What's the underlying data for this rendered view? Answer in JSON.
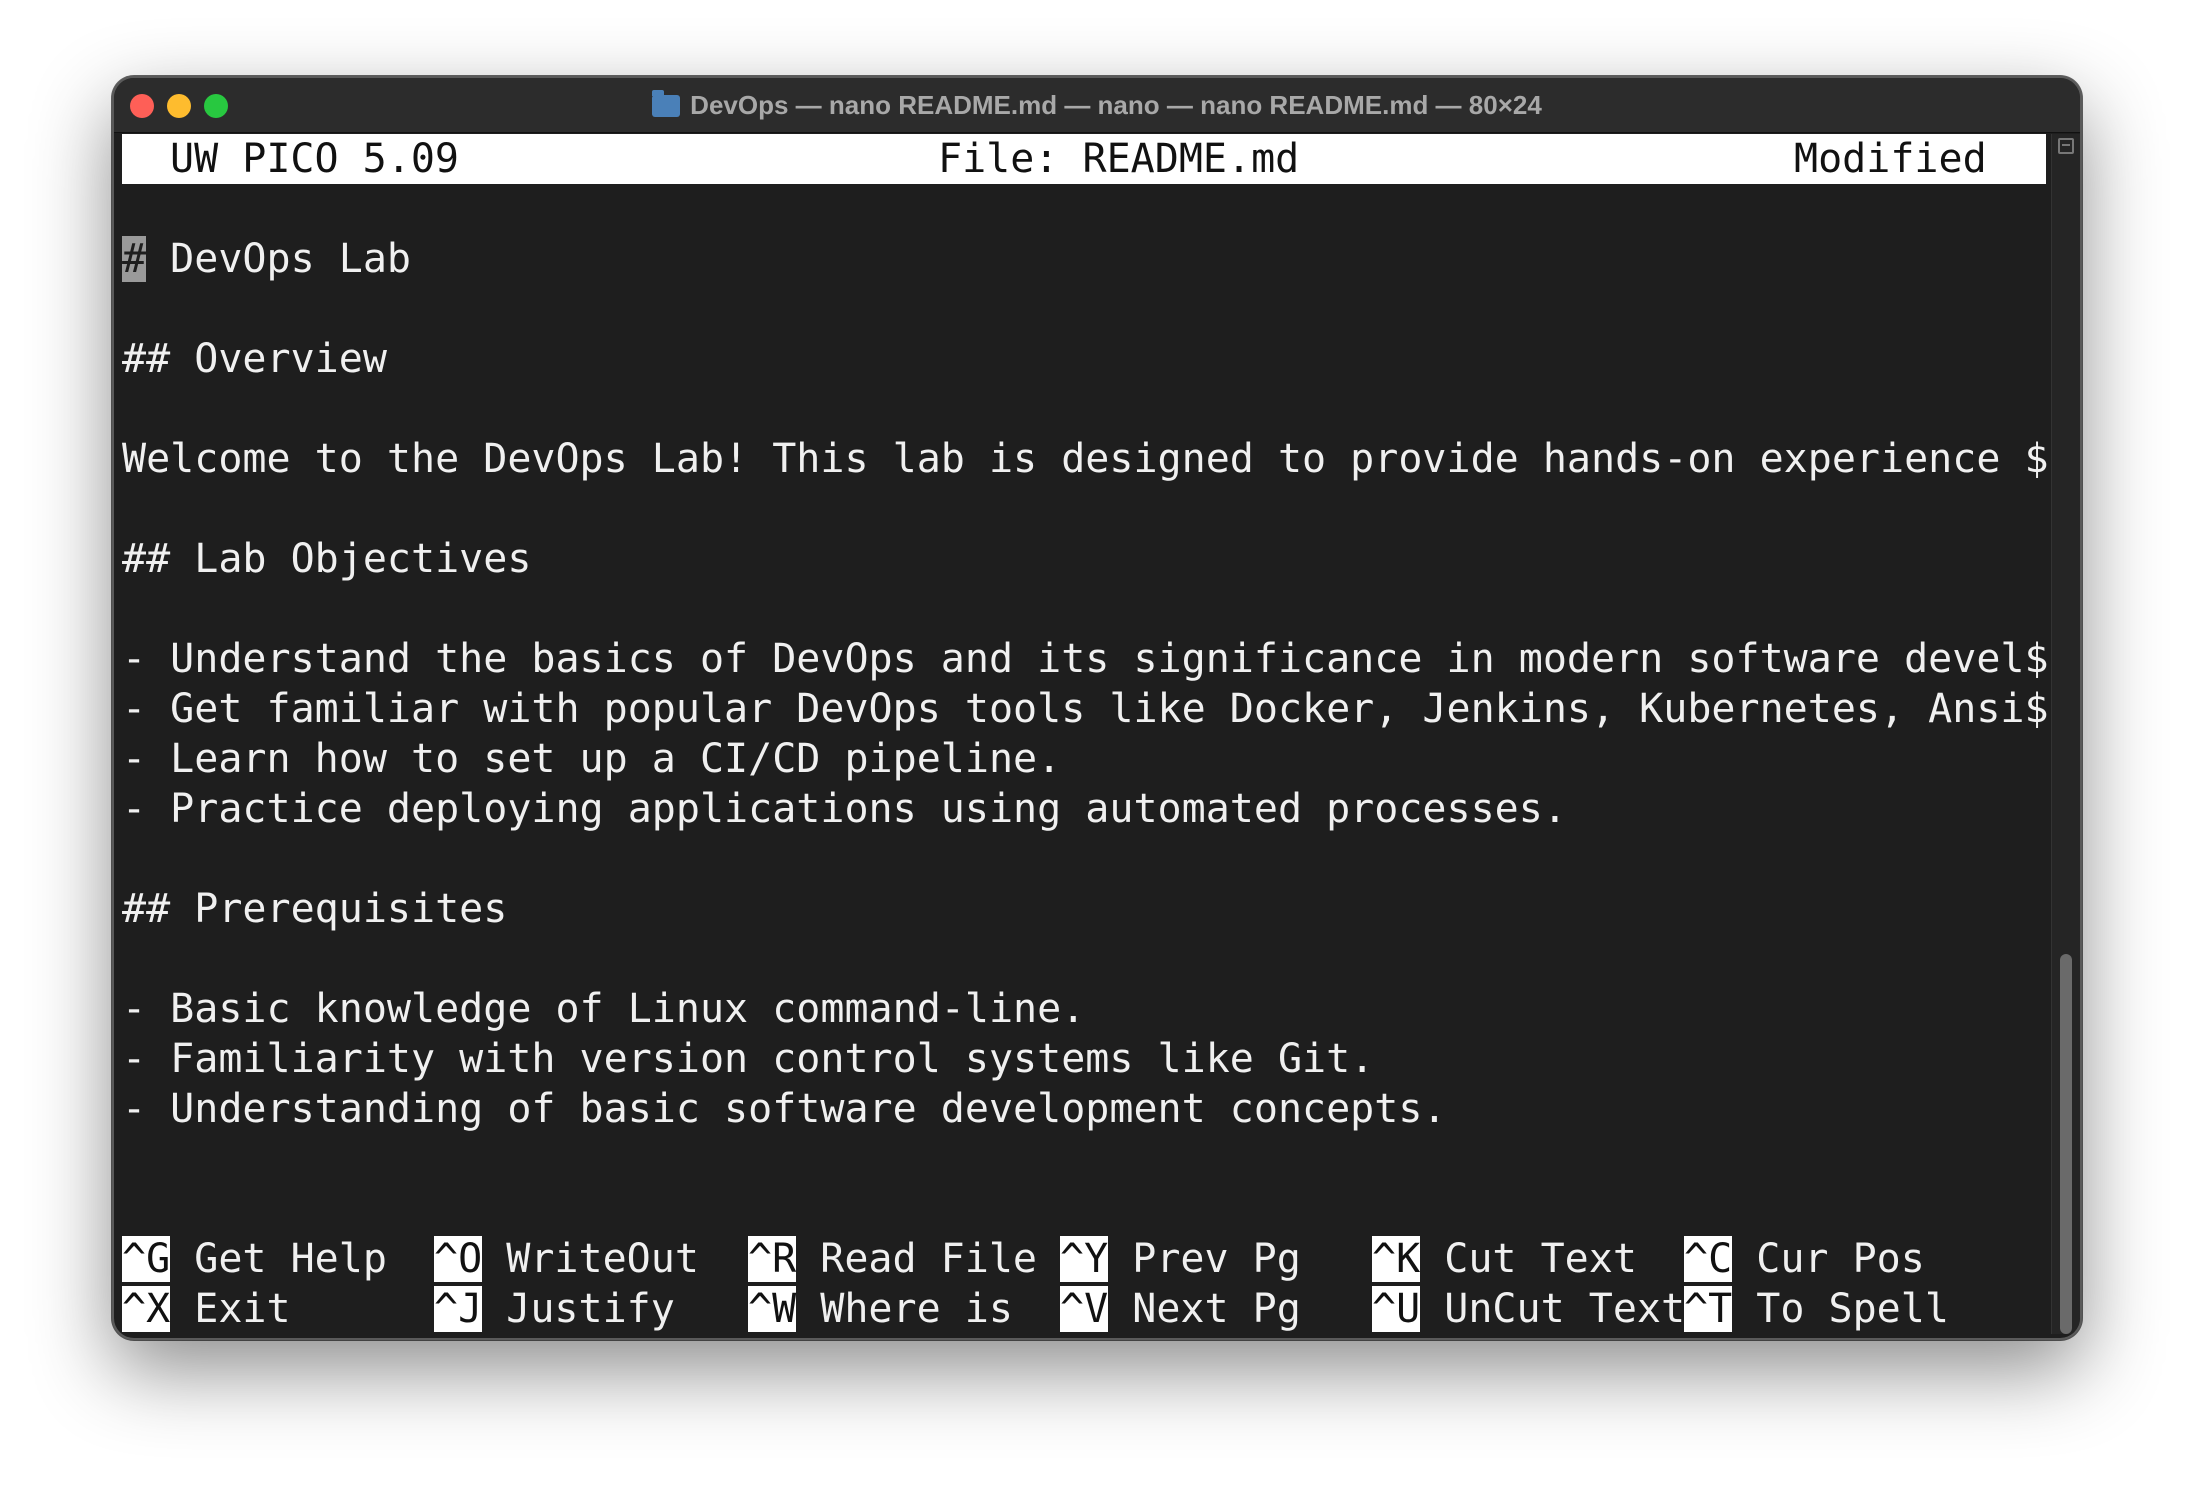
{
  "window": {
    "title": "DevOps — nano README.md — nano — nano README.md — 80×24",
    "traffic_colors": {
      "close": "#fe5f57",
      "minimize": "#febc2e",
      "maximize": "#28c840"
    }
  },
  "nano": {
    "app_name": "UW PICO 5.09",
    "file_label": "File: README.md",
    "status": "Modified"
  },
  "content": {
    "cursor_char": "#",
    "line1_rest": " DevOps Lab",
    "line2": "## Overview",
    "line3": "Welcome to the DevOps Lab! This lab is designed to provide hands-on experience $",
    "line4": "## Lab Objectives",
    "line5": "- Understand the basics of DevOps and its significance in modern software devel$",
    "line6": "- Get familiar with popular DevOps tools like Docker, Jenkins, Kubernetes, Ansi$",
    "line7": "- Learn how to set up a CI/CD pipeline.",
    "line8": "- Practice deploying applications using automated processes.",
    "line9": "## Prerequisites",
    "line10": "- Basic knowledge of Linux command-line.",
    "line11": "- Familiarity with version control systems like Git.",
    "line12": "- Understanding of basic software development concepts."
  },
  "shortcuts": [
    {
      "key": "^G",
      "label": " Get Help"
    },
    {
      "key": "^O",
      "label": " WriteOut"
    },
    {
      "key": "^R",
      "label": " Read File"
    },
    {
      "key": "^Y",
      "label": " Prev Pg"
    },
    {
      "key": "^K",
      "label": " Cut Text"
    },
    {
      "key": "^C",
      "label": " Cur Pos"
    },
    {
      "key": "^X",
      "label": " Exit"
    },
    {
      "key": "^J",
      "label": " Justify"
    },
    {
      "key": "^W",
      "label": " Where is"
    },
    {
      "key": "^V",
      "label": " Next Pg"
    },
    {
      "key": "^U",
      "label": " UnCut Text"
    },
    {
      "key": "^T",
      "label": " To Spell"
    }
  ]
}
